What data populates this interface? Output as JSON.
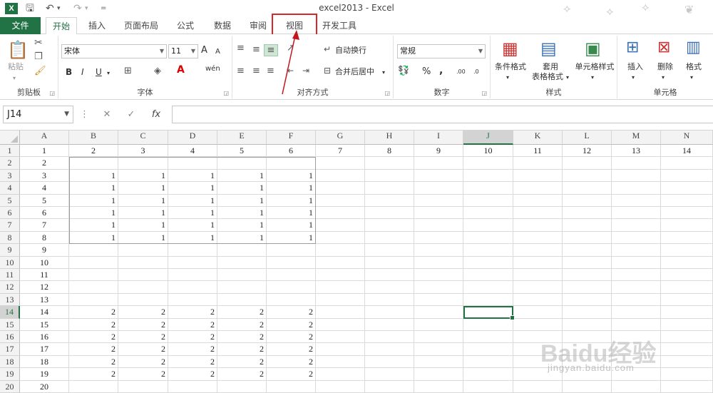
{
  "window": {
    "title": "excel2013 - Excel",
    "app_badge": "X"
  },
  "tabs": {
    "file": "文件",
    "items": [
      "开始",
      "插入",
      "页面布局",
      "公式",
      "数据",
      "审阅",
      "视图",
      "开发工具"
    ],
    "active": "开始",
    "highlighted": "视图"
  },
  "ribbon": {
    "clipboard": {
      "label": "剪贴板",
      "paste": "粘贴"
    },
    "font": {
      "label": "字体",
      "name": "宋体",
      "size": "11",
      "grow": "A",
      "shrink": "A",
      "bold": "B",
      "italic": "I",
      "underline": "U",
      "phonetic": "wén"
    },
    "alignment": {
      "label": "对齐方式",
      "wrap_text": "自动换行",
      "merge_center": "合并后居中"
    },
    "number": {
      "label": "数字",
      "format": "常规",
      "percent": "%",
      "comma": ",",
      "inc_decimal": ".00",
      "dec_decimal": ".0"
    },
    "styles": {
      "label": "样式",
      "conditional": "条件格式",
      "table_format_1": "套用",
      "table_format_2": "表格格式",
      "cell_styles": "单元格样式"
    },
    "cells": {
      "label": "单元格",
      "insert": "插入",
      "delete": "删除",
      "format": "格式"
    }
  },
  "formula_bar": {
    "name_box": "J14",
    "content": ""
  },
  "grid": {
    "columns": [
      "A",
      "B",
      "C",
      "D",
      "E",
      "F",
      "G",
      "H",
      "I",
      "J",
      "K",
      "L",
      "M",
      "N"
    ],
    "selected_column": "J",
    "selected_row": 14,
    "rows": [
      [
        "1",
        "2",
        "3",
        "4",
        "5",
        "6",
        "7",
        "8",
        "9",
        "10",
        "11",
        "12",
        "13",
        "14"
      ],
      [
        "2"
      ],
      [
        "3",
        "1",
        "1",
        "1",
        "1",
        "1"
      ],
      [
        "4",
        "1",
        "1",
        "1",
        "1",
        "1"
      ],
      [
        "5",
        "1",
        "1",
        "1",
        "1",
        "1"
      ],
      [
        "6",
        "1",
        "1",
        "1",
        "1",
        "1"
      ],
      [
        "7",
        "1",
        "1",
        "1",
        "1",
        "1"
      ],
      [
        "8",
        "1",
        "1",
        "1",
        "1",
        "1"
      ],
      [
        "9"
      ],
      [
        "10"
      ],
      [
        "11"
      ],
      [
        "12"
      ],
      [
        "13"
      ],
      [
        "14",
        "2",
        "2",
        "2",
        "2",
        "2"
      ],
      [
        "15",
        "2",
        "2",
        "2",
        "2",
        "2"
      ],
      [
        "16",
        "2",
        "2",
        "2",
        "2",
        "2"
      ],
      [
        "17",
        "2",
        "2",
        "2",
        "2",
        "2"
      ],
      [
        "18",
        "2",
        "2",
        "2",
        "2",
        "2"
      ],
      [
        "19",
        "2",
        "2",
        "2",
        "2",
        "2"
      ],
      [
        "20"
      ]
    ]
  },
  "watermark": {
    "brand": "Baidu经验",
    "sub": "jingyan.baidu.com"
  },
  "colors": {
    "excel_green": "#217346",
    "highlight_red": "#d9262a"
  }
}
